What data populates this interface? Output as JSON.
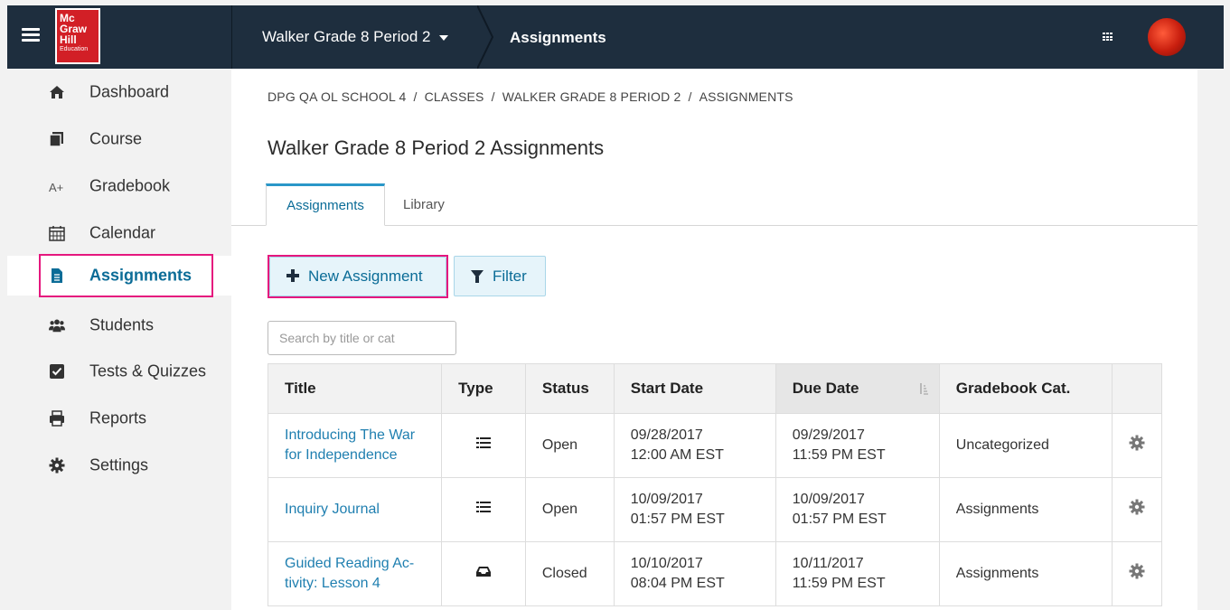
{
  "topbar": {
    "logo": {
      "line1": "Mc",
      "line2": "Graw",
      "line3": "Hill",
      "line4": "Education"
    },
    "class_select": "Walker Grade 8 Period 2",
    "section": "Assignments"
  },
  "sidebar": {
    "items": [
      {
        "label": "Dashboard",
        "icon": "home-icon"
      },
      {
        "label": "Course",
        "icon": "course-icon"
      },
      {
        "label": "Gradebook",
        "icon": "gradebook-icon"
      },
      {
        "label": "Calendar",
        "icon": "calendar-icon"
      },
      {
        "label": "Assignments",
        "icon": "document-icon",
        "active": true
      },
      {
        "label": "Students",
        "icon": "users-icon"
      },
      {
        "label": "Tests & Quizzes",
        "icon": "checkbox-icon"
      },
      {
        "label": "Reports",
        "icon": "printer-icon"
      },
      {
        "label": "Settings",
        "icon": "gear-icon"
      }
    ]
  },
  "main": {
    "breadcrumb": [
      "DPG QA OL SCHOOL 4",
      "CLASSES",
      "WALKER GRADE 8 PERIOD 2",
      "ASSIGNMENTS"
    ],
    "breadcrumb_sep": "/",
    "title": "Walker Grade 8 Period 2 Assignments",
    "tabs": [
      {
        "label": "Assignments",
        "active": true
      },
      {
        "label": "Library",
        "active": false
      }
    ],
    "new_button": "New Assignment",
    "filter_button": "Filter",
    "search_placeholder": "Search by title or cat",
    "table": {
      "headers": [
        "Title",
        "Type",
        "Status",
        "Start Date",
        "Due Date",
        "Gradebook Cat."
      ],
      "rows": [
        {
          "title1": "Introducing The War",
          "title2": "for Independence",
          "type_icon": "list-icon",
          "status": "Open",
          "start1": "09/28/2017",
          "start2": "12:00 AM EST",
          "due1": "09/29/2017",
          "due2": "11:59 PM EST",
          "category": "Uncategorized"
        },
        {
          "title1": "Inquiry Journal",
          "title2": "",
          "type_icon": "list-icon",
          "status": "Open",
          "start1": "10/09/2017",
          "start2": "01:57 PM EST",
          "due1": "10/09/2017",
          "due2": "01:57 PM EST",
          "category": "Assignments"
        },
        {
          "title1": "Guided Reading Ac-",
          "title2": "tivity: Lesson 4",
          "type_icon": "inbox-icon",
          "status": "Closed",
          "start1": "10/10/2017",
          "start2": "08:04 PM EST",
          "due1": "10/11/2017",
          "due2": "11:59 PM EST",
          "category": "Assignments"
        }
      ]
    }
  },
  "colors": {
    "topbar": "#1e2e3e",
    "accent": "#0b6c97",
    "highlight": "#e5177e",
    "brand_red": "#d21f26"
  }
}
